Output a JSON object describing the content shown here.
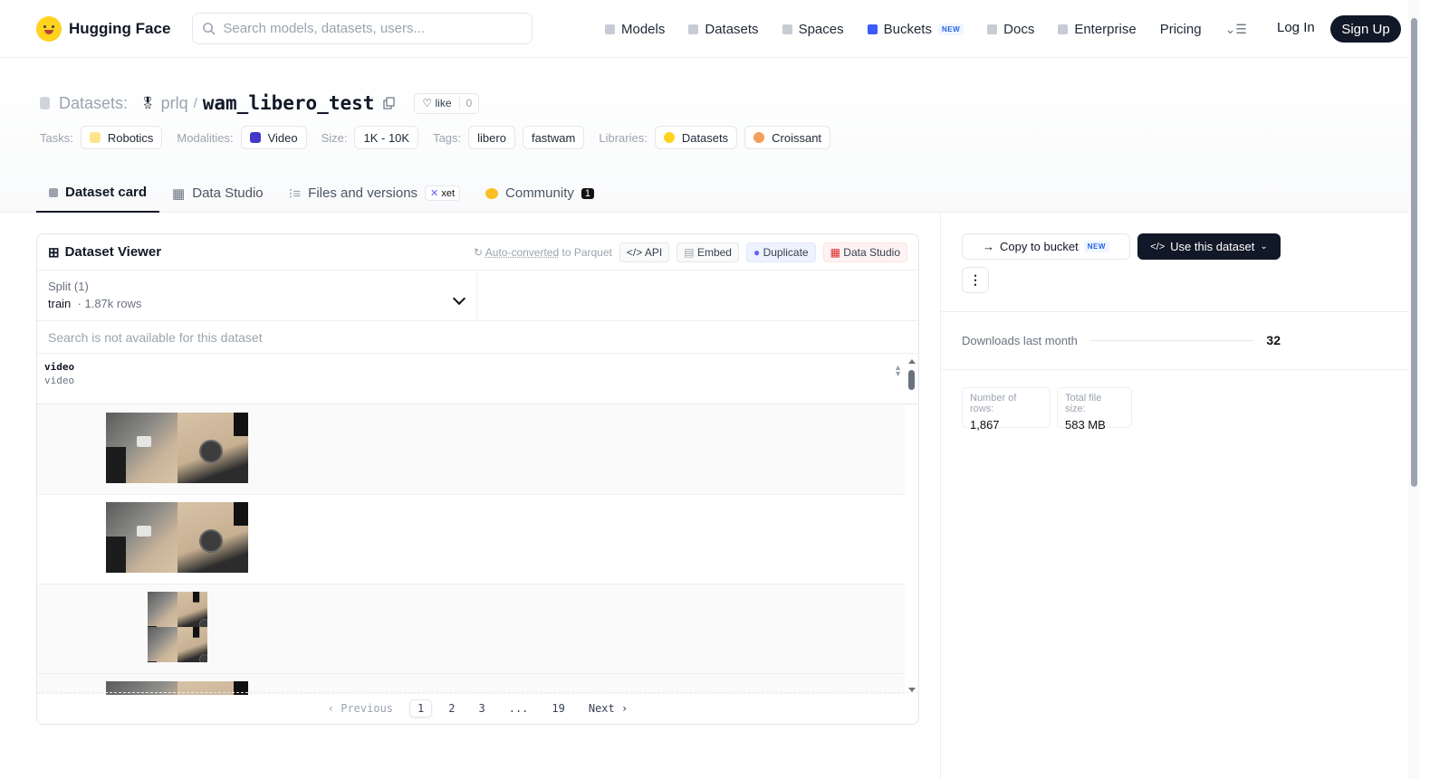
{
  "header": {
    "brand": "Hugging Face",
    "search_placeholder": "Search models, datasets, users...",
    "nav": [
      "Models",
      "Datasets",
      "Spaces",
      "Buckets",
      "Docs",
      "Enterprise",
      "Pricing"
    ],
    "new_badge": "NEW",
    "login": "Log In",
    "signup": "Sign Up"
  },
  "repo": {
    "type_label": "Datasets:",
    "owner": "prlq",
    "separator": "/",
    "name": "wam_libero_test",
    "like_label": "like",
    "like_count": "0"
  },
  "meta": {
    "tasks_label": "Tasks:",
    "task": "Robotics",
    "modalities_label": "Modalities:",
    "modality": "Video",
    "size_label": "Size:",
    "size": "1K - 10K",
    "tags_label": "Tags:",
    "tags": [
      "libero",
      "fastwam"
    ],
    "libraries_label": "Libraries:",
    "libraries": [
      "Datasets",
      "Croissant"
    ]
  },
  "tabs": {
    "card": "Dataset card",
    "studio": "Data Studio",
    "files": "Files and versions",
    "xet": "xet",
    "community": "Community",
    "community_count": "1"
  },
  "viewer": {
    "title": "Dataset Viewer",
    "auto_converted": "Auto-converted",
    "to_parquet": " to Parquet",
    "api": "API",
    "embed": "Embed",
    "duplicate": "Duplicate",
    "data_studio": "Data Studio",
    "split_label": "Split (1)",
    "split_value": "train",
    "split_rows": "1.87k rows",
    "search_unavailable": "Search is not available for this dataset",
    "column_name": "video",
    "column_type": "video",
    "pager": {
      "previous": "Previous",
      "pages": [
        "1",
        "2",
        "3",
        "...",
        "19"
      ],
      "next": "Next",
      "current": "1"
    }
  },
  "sidebar": {
    "copy_to_bucket": "Copy to bucket",
    "new_badge": "NEW",
    "use_dataset": "Use this dataset",
    "downloads_label": "Downloads last month",
    "downloads_value": "32",
    "rows_label": "Number of rows:",
    "rows_value": "1,867",
    "size_label": "Total file size:",
    "size_value": "583 MB"
  },
  "colors": {
    "primary_dark": "#111827",
    "accent_blue": "#2563eb",
    "brand_yellow": "#ffd21e"
  }
}
